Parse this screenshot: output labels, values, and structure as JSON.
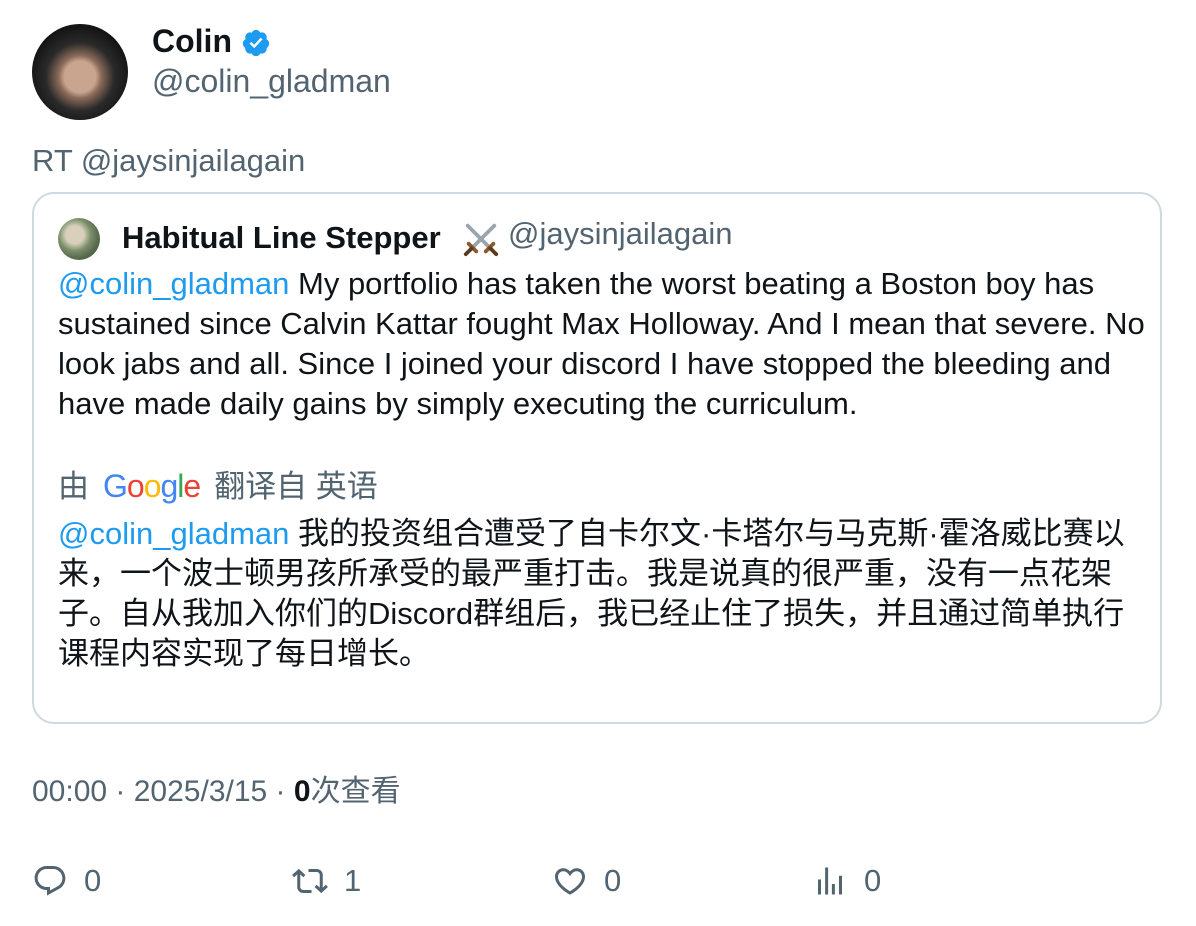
{
  "author": {
    "display_name": "Colin",
    "handle": "@colin_gladman",
    "verified_icon": "verified-badge-icon",
    "verified_color": "#1d9bf0"
  },
  "retweet_line": "RT @jaysinjailagain",
  "quoted_tweet": {
    "display_name": "Habitual Line Stepper",
    "name_emoji": "⚔️",
    "handle": "@jaysinjailagain",
    "mention": "@colin_gladman",
    "text": " My portfolio has taken the worst beating a Boston boy has sustained since Calvin Kattar fought Max Holloway. And I mean that severe. No look jabs and all. Since I joined your discord I have stopped the bleeding and have made daily gains by simply executing the curriculum.",
    "translation_prefix": "由",
    "translation_provider": "Google",
    "translation_suffix": "翻译自 英语",
    "translated_mention": "@colin_gladman",
    "translated_text": " 我的投资组合遭受了自卡尔文·卡塔尔与马克斯·霍洛威比赛以来，一个波士顿男孩所承受的最严重打击。我是说真的很严重，没有一点花架子。自从我加入你们的Discord群组后，我已经止住了损失，并且通过简单执行课程内容实现了每日增长。"
  },
  "meta": {
    "time": "00:00",
    "separator1": " · ",
    "date": "2025/3/15",
    "separator2": " · ",
    "views_count": "0",
    "views_label": "次查看"
  },
  "actions": {
    "reply": {
      "icon": "reply-icon",
      "count": "0"
    },
    "retweet": {
      "icon": "retweet-icon",
      "count": "1"
    },
    "like": {
      "icon": "like-icon",
      "count": "0"
    },
    "views": {
      "icon": "views-icon",
      "count": "0"
    }
  },
  "colors": {
    "text_primary": "#0f1419",
    "text_secondary": "#536471",
    "accent": "#1d9bf0",
    "border": "#cfd9de"
  }
}
